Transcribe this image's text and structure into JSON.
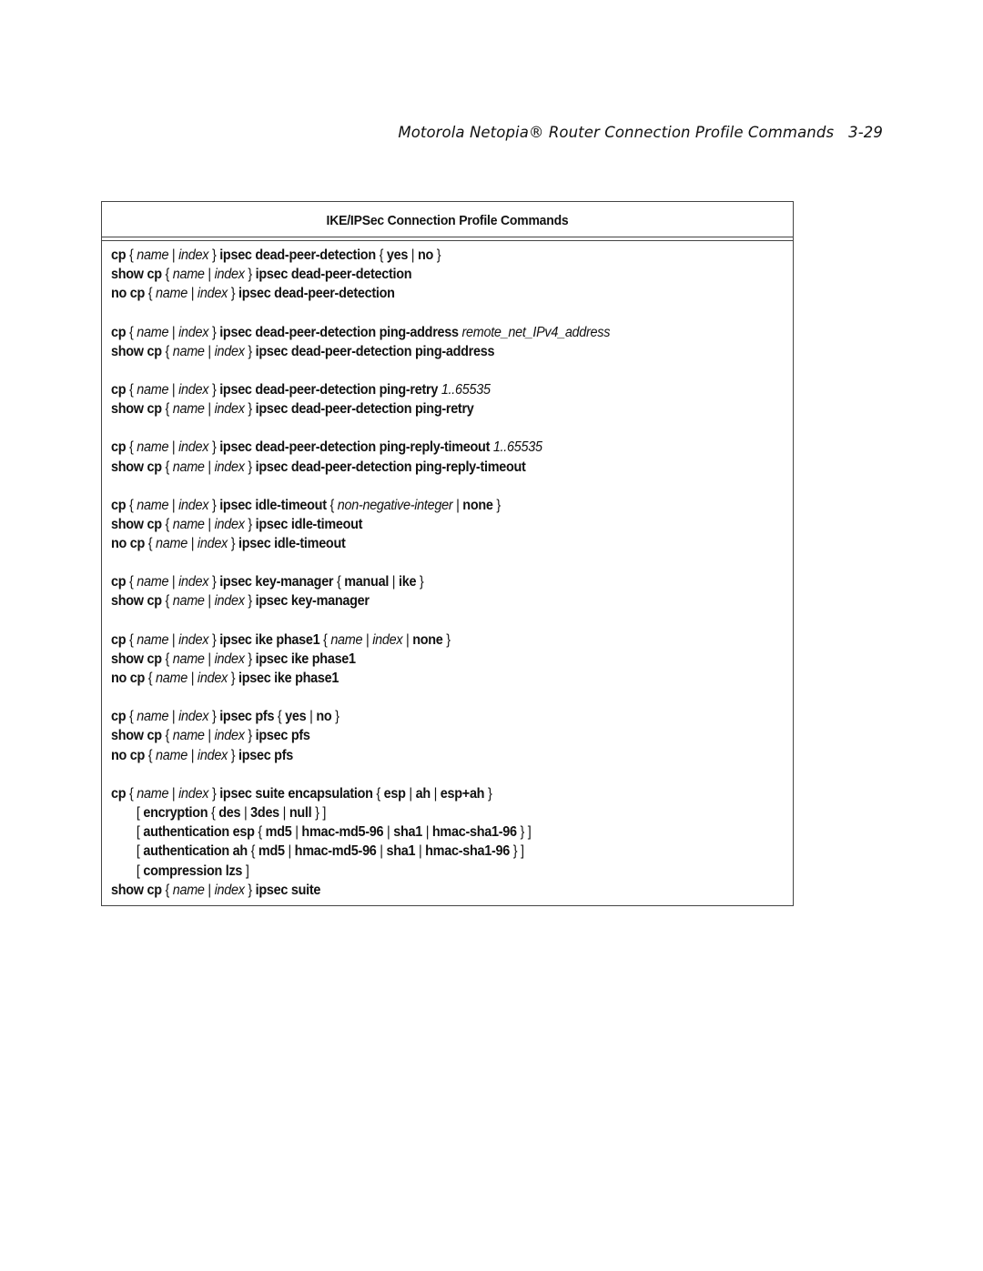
{
  "header": {
    "title": "Motorola Netopia® Router Connection Profile Commands",
    "page_number": "3-29"
  },
  "table": {
    "title": "IKE/IPSec Connection Profile Commands",
    "groups": [
      {
        "lines": [
          [
            [
              "b",
              "cp"
            ],
            [
              "p",
              " { "
            ],
            [
              "i",
              "name"
            ],
            [
              "p",
              " | "
            ],
            [
              "i",
              "index"
            ],
            [
              "p",
              " } "
            ],
            [
              "b",
              "ipsec dead-peer-detection"
            ],
            [
              "p",
              " { "
            ],
            [
              "b",
              "yes"
            ],
            [
              "p",
              " | "
            ],
            [
              "b",
              "no"
            ],
            [
              "p",
              " }"
            ]
          ],
          [
            [
              "b",
              "show cp"
            ],
            [
              "p",
              " { "
            ],
            [
              "i",
              "name"
            ],
            [
              "p",
              " | "
            ],
            [
              "i",
              "index"
            ],
            [
              "p",
              " } "
            ],
            [
              "b",
              "ipsec dead-peer-detection"
            ]
          ],
          [
            [
              "b",
              "no cp"
            ],
            [
              "p",
              " { "
            ],
            [
              "i",
              "name"
            ],
            [
              "p",
              " | "
            ],
            [
              "i",
              "index"
            ],
            [
              "p",
              " } "
            ],
            [
              "b",
              "ipsec dead-peer-detection"
            ]
          ]
        ]
      },
      {
        "lines": [
          [
            [
              "b",
              "cp"
            ],
            [
              "p",
              " { "
            ],
            [
              "i",
              "name"
            ],
            [
              "p",
              " | "
            ],
            [
              "i",
              "index"
            ],
            [
              "p",
              " } "
            ],
            [
              "b",
              "ipsec dead-peer-detection ping-address"
            ],
            [
              "p",
              " "
            ],
            [
              "i",
              "remote_net_IPv4_address"
            ]
          ],
          [
            [
              "b",
              "show cp"
            ],
            [
              "p",
              " { "
            ],
            [
              "i",
              "name"
            ],
            [
              "p",
              " | "
            ],
            [
              "i",
              "index"
            ],
            [
              "p",
              " } "
            ],
            [
              "b",
              "ipsec dead-peer-detection ping-address"
            ]
          ]
        ]
      },
      {
        "lines": [
          [
            [
              "b",
              "cp"
            ],
            [
              "p",
              " { "
            ],
            [
              "i",
              "name"
            ],
            [
              "p",
              " | "
            ],
            [
              "i",
              "index"
            ],
            [
              "p",
              " } "
            ],
            [
              "b",
              "ipsec dead-peer-detection ping-retry"
            ],
            [
              "p",
              " "
            ],
            [
              "i",
              "1..65535"
            ]
          ],
          [
            [
              "b",
              "show cp"
            ],
            [
              "p",
              " { "
            ],
            [
              "i",
              "name"
            ],
            [
              "p",
              " | "
            ],
            [
              "i",
              "index"
            ],
            [
              "p",
              " } "
            ],
            [
              "b",
              "ipsec dead-peer-detection ping-retry"
            ]
          ]
        ]
      },
      {
        "lines": [
          [
            [
              "b",
              "cp"
            ],
            [
              "p",
              " { "
            ],
            [
              "i",
              "name"
            ],
            [
              "p",
              " | "
            ],
            [
              "i",
              "index"
            ],
            [
              "p",
              " } "
            ],
            [
              "b",
              "ipsec dead-peer-detection ping-reply-timeout"
            ],
            [
              "p",
              " "
            ],
            [
              "i",
              "1..65535"
            ]
          ],
          [
            [
              "b",
              "show cp"
            ],
            [
              "p",
              " { "
            ],
            [
              "i",
              "name"
            ],
            [
              "p",
              " | "
            ],
            [
              "i",
              "index"
            ],
            [
              "p",
              " } "
            ],
            [
              "b",
              "ipsec dead-peer-detection ping-reply-timeout"
            ]
          ]
        ]
      },
      {
        "lines": [
          [
            [
              "b",
              "cp"
            ],
            [
              "p",
              " { "
            ],
            [
              "i",
              "name"
            ],
            [
              "p",
              " | "
            ],
            [
              "i",
              "index"
            ],
            [
              "p",
              " } "
            ],
            [
              "b",
              "ipsec idle-timeout"
            ],
            [
              "p",
              " { "
            ],
            [
              "i",
              "non-negative-integer"
            ],
            [
              "p",
              " | "
            ],
            [
              "b",
              "none"
            ],
            [
              "p",
              " }"
            ]
          ],
          [
            [
              "b",
              "show cp"
            ],
            [
              "p",
              " { "
            ],
            [
              "i",
              "name"
            ],
            [
              "p",
              " | "
            ],
            [
              "i",
              "index"
            ],
            [
              "p",
              " } "
            ],
            [
              "b",
              "ipsec idle-timeout"
            ]
          ],
          [
            [
              "b",
              "no cp"
            ],
            [
              "p",
              " { "
            ],
            [
              "i",
              "name"
            ],
            [
              "p",
              " | "
            ],
            [
              "i",
              "index"
            ],
            [
              "p",
              " } "
            ],
            [
              "b",
              "ipsec idle-timeout"
            ]
          ]
        ]
      },
      {
        "lines": [
          [
            [
              "b",
              "cp"
            ],
            [
              "p",
              " { "
            ],
            [
              "i",
              "name"
            ],
            [
              "p",
              " | "
            ],
            [
              "i",
              "index"
            ],
            [
              "p",
              " } "
            ],
            [
              "b",
              "ipsec key-manager"
            ],
            [
              "p",
              " { "
            ],
            [
              "b",
              "manual"
            ],
            [
              "p",
              " | "
            ],
            [
              "b",
              "ike"
            ],
            [
              "p",
              " }"
            ]
          ],
          [
            [
              "b",
              "show cp"
            ],
            [
              "p",
              " { "
            ],
            [
              "i",
              "name"
            ],
            [
              "p",
              " | "
            ],
            [
              "i",
              "index"
            ],
            [
              "p",
              " } "
            ],
            [
              "b",
              "ipsec key-manager"
            ]
          ]
        ]
      },
      {
        "lines": [
          [
            [
              "b",
              "cp"
            ],
            [
              "p",
              " { "
            ],
            [
              "i",
              "name"
            ],
            [
              "p",
              " | "
            ],
            [
              "i",
              "index"
            ],
            [
              "p",
              " } "
            ],
            [
              "b",
              "ipsec ike phase1"
            ],
            [
              "p",
              " { "
            ],
            [
              "i",
              "name"
            ],
            [
              "p",
              " | "
            ],
            [
              "i",
              "index"
            ],
            [
              "p",
              " | "
            ],
            [
              "b",
              "none"
            ],
            [
              "p",
              " }"
            ]
          ],
          [
            [
              "b",
              "show cp"
            ],
            [
              "p",
              " { "
            ],
            [
              "i",
              "name"
            ],
            [
              "p",
              " | "
            ],
            [
              "i",
              "index"
            ],
            [
              "p",
              " } "
            ],
            [
              "b",
              "ipsec ike phase1"
            ]
          ],
          [
            [
              "b",
              "no cp"
            ],
            [
              "p",
              " { "
            ],
            [
              "i",
              "name"
            ],
            [
              "p",
              " | "
            ],
            [
              "i",
              "index"
            ],
            [
              "p",
              " } "
            ],
            [
              "b",
              "ipsec ike phase1"
            ]
          ]
        ]
      },
      {
        "lines": [
          [
            [
              "b",
              "cp"
            ],
            [
              "p",
              " { "
            ],
            [
              "i",
              "name"
            ],
            [
              "p",
              " | "
            ],
            [
              "i",
              "index"
            ],
            [
              "p",
              " } "
            ],
            [
              "b",
              "ipsec pfs"
            ],
            [
              "p",
              " { "
            ],
            [
              "b",
              "yes"
            ],
            [
              "p",
              " | "
            ],
            [
              "b",
              "no"
            ],
            [
              "p",
              " }"
            ]
          ],
          [
            [
              "b",
              "show cp"
            ],
            [
              "p",
              " { "
            ],
            [
              "i",
              "name"
            ],
            [
              "p",
              " | "
            ],
            [
              "i",
              "index"
            ],
            [
              "p",
              " } "
            ],
            [
              "b",
              "ipsec pfs"
            ]
          ],
          [
            [
              "b",
              "no cp"
            ],
            [
              "p",
              " { "
            ],
            [
              "i",
              "name"
            ],
            [
              "p",
              " | "
            ],
            [
              "i",
              "index"
            ],
            [
              "p",
              " } "
            ],
            [
              "b",
              "ipsec pfs"
            ]
          ]
        ]
      },
      {
        "lines": [
          [
            [
              "b",
              "cp"
            ],
            [
              "p",
              " { "
            ],
            [
              "i",
              "name"
            ],
            [
              "p",
              " | "
            ],
            [
              "i",
              "index"
            ],
            [
              "p",
              " } "
            ],
            [
              "b",
              "ipsec suite encapsulation"
            ],
            [
              "p",
              " { "
            ],
            [
              "b",
              "esp"
            ],
            [
              "p",
              " | "
            ],
            [
              "b",
              "ah"
            ],
            [
              "p",
              " | "
            ],
            [
              "b",
              "esp+ah"
            ],
            [
              "p",
              " }"
            ]
          ],
          {
            "indent": true,
            "parts": [
              [
                "p",
                "[ "
              ],
              [
                "b",
                "encryption"
              ],
              [
                "p",
                " { "
              ],
              [
                "b",
                "des"
              ],
              [
                "p",
                " | "
              ],
              [
                "b",
                "3des"
              ],
              [
                "p",
                " | "
              ],
              [
                "b",
                "null"
              ],
              [
                "p",
                " } ]"
              ]
            ]
          },
          {
            "indent": true,
            "parts": [
              [
                "p",
                "[ "
              ],
              [
                "b",
                "authentication esp"
              ],
              [
                "p",
                " { "
              ],
              [
                "b",
                "md5"
              ],
              [
                "p",
                " | "
              ],
              [
                "b",
                "hmac-md5-96"
              ],
              [
                "p",
                " | "
              ],
              [
                "b",
                "sha1"
              ],
              [
                "p",
                " | "
              ],
              [
                "b",
                "hmac-sha1-96"
              ],
              [
                "p",
                " } ]"
              ]
            ]
          },
          {
            "indent": true,
            "parts": [
              [
                "p",
                "[ "
              ],
              [
                "b",
                "authentication ah"
              ],
              [
                "p",
                " { "
              ],
              [
                "b",
                "md5"
              ],
              [
                "p",
                " | "
              ],
              [
                "b",
                "hmac-md5-96"
              ],
              [
                "p",
                " | "
              ],
              [
                "b",
                "sha1"
              ],
              [
                "p",
                " | "
              ],
              [
                "b",
                "hmac-sha1-96"
              ],
              [
                "p",
                " } ]"
              ]
            ]
          },
          {
            "indent": true,
            "parts": [
              [
                "p",
                "[ "
              ],
              [
                "b",
                "compression lzs"
              ],
              [
                "p",
                " ]"
              ]
            ]
          },
          [
            [
              "b",
              "show cp"
            ],
            [
              "p",
              " { "
            ],
            [
              "i",
              "name"
            ],
            [
              "p",
              " | "
            ],
            [
              "i",
              "index"
            ],
            [
              "p",
              " } "
            ],
            [
              "b",
              "ipsec suite"
            ]
          ]
        ]
      }
    ]
  }
}
